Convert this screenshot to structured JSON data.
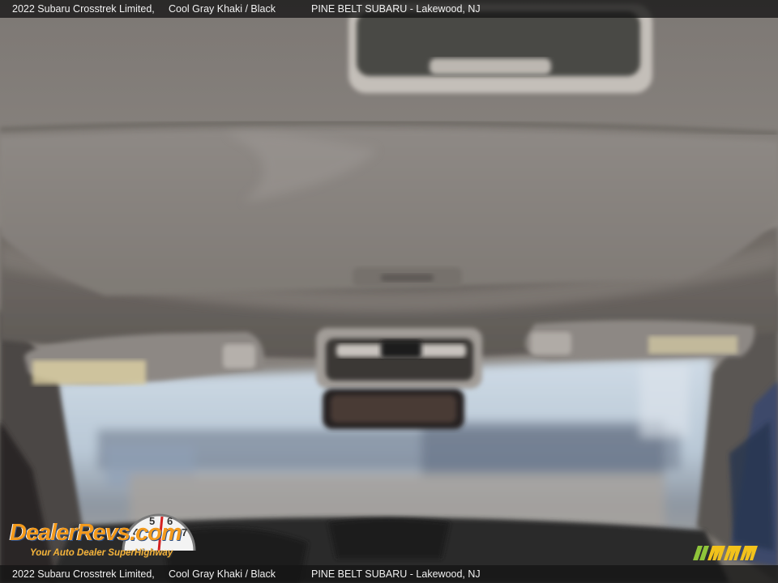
{
  "caption": {
    "vehicle": "2022 Subaru Crosstrek Limited,",
    "color": "Cool Gray Khaki / Black",
    "dealer": "PINE BELT SUBARU - Lakewood, NJ"
  },
  "watermark": {
    "brand": "DealerRevs.com",
    "tagline": "Your Auto Dealer SuperHighway",
    "gauge_digits": [
      "4",
      "5",
      "6",
      "7"
    ],
    "colors": {
      "orange": "#f39a1c",
      "blue": "#2a4f8a"
    }
  },
  "corner_logo": {
    "name": "mmm-logo",
    "colors": {
      "green": "#8fc43a",
      "yellow": "#f2c21b"
    }
  },
  "scene": {
    "subject": "car-interior-headliner",
    "colors": {
      "headliner": "#8a8580",
      "sky": "#c8d8e6",
      "lot": "#7a8190"
    }
  }
}
